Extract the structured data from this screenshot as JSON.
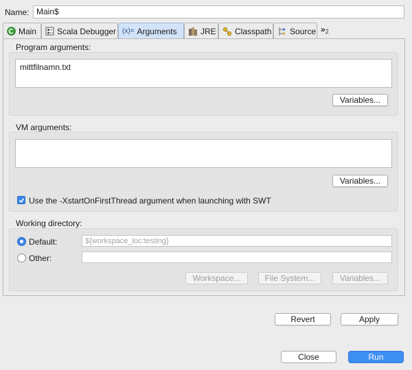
{
  "name_row": {
    "label": "Name:",
    "value": "Main$"
  },
  "tabs": [
    {
      "label": "Main",
      "icon": "main-circle-icon",
      "active": false
    },
    {
      "label": "Scala Debugger",
      "icon": "debugger-icon",
      "active": false
    },
    {
      "label": "Arguments",
      "icon": "arguments-icon",
      "icon_text": "(x)=",
      "active": true
    },
    {
      "label": "JRE",
      "icon": "jre-icon",
      "active": false
    },
    {
      "label": "Classpath",
      "icon": "classpath-icon",
      "active": false
    },
    {
      "label": "Source",
      "icon": "source-icon",
      "active": false
    }
  ],
  "tab_overflow": {
    "glyph": "»",
    "count": "2"
  },
  "program_arguments": {
    "title": "Program arguments:",
    "value": "mittfilnamn.txt",
    "variables_label": "Variables..."
  },
  "vm_arguments": {
    "title": "VM arguments:",
    "value": "",
    "variables_label": "Variables...",
    "checkbox_label": "Use the -XstartOnFirstThread argument when launching with SWT",
    "checkbox_checked": true
  },
  "working_directory": {
    "title": "Working directory:",
    "default_label": "Default:",
    "default_value": "${workspace_loc:testing}",
    "other_label": "Other:",
    "other_value": "",
    "selected": "default",
    "workspace_label": "Workspace...",
    "filesystem_label": "File System...",
    "variables_label": "Variables..."
  },
  "actions": {
    "revert": "Revert",
    "apply": "Apply"
  },
  "dialog": {
    "close": "Close",
    "run": "Run"
  },
  "colors": {
    "accent": "#3d8ff2",
    "active_tab": "#d2e3f7"
  }
}
